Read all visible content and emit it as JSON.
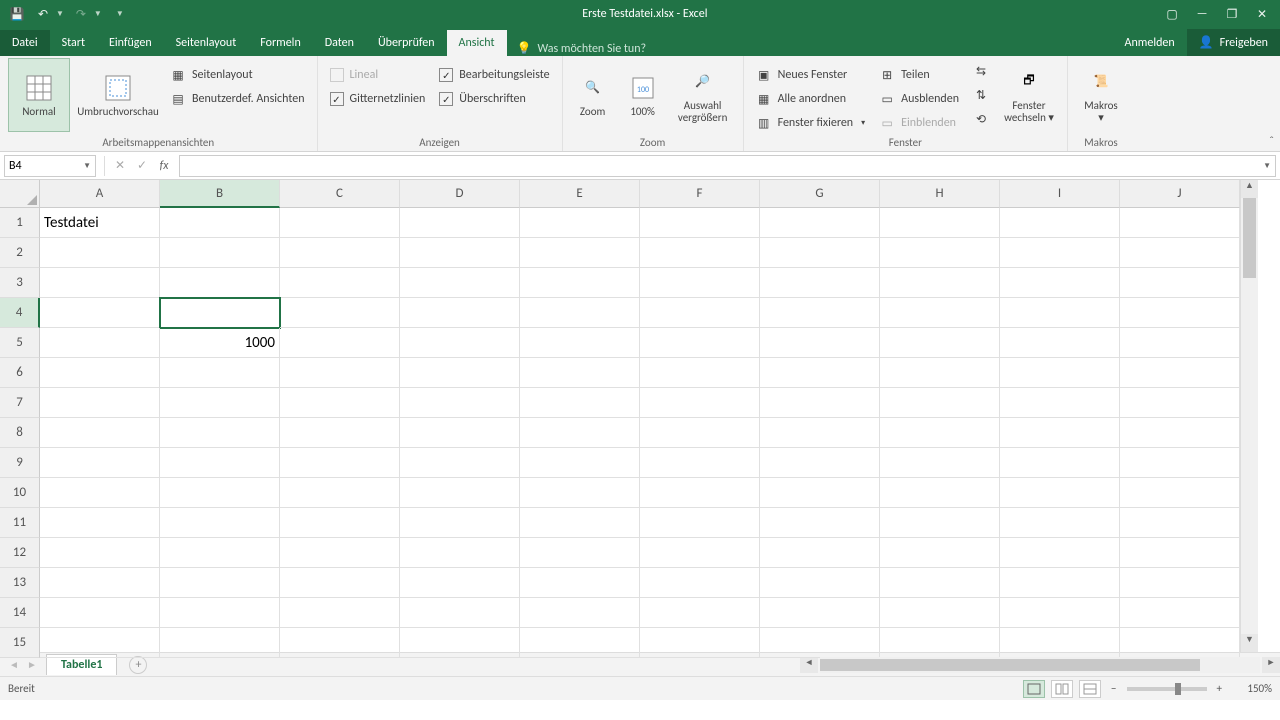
{
  "title": "Erste Testdatei.xlsx - Excel",
  "qat": {
    "save": "💾",
    "undo": "↶",
    "redo": "↷"
  },
  "tabs": {
    "file": "Datei",
    "start": "Start",
    "einfuegen": "Einfügen",
    "seitenlayout": "Seitenlayout",
    "formeln": "Formeln",
    "daten": "Daten",
    "ueberpruefen": "Überprüfen",
    "ansicht": "Ansicht",
    "tellme_placeholder": "Was möchten Sie tun?",
    "anmelden": "Anmelden",
    "freigeben": "Freigeben"
  },
  "ribbon": {
    "views": {
      "normal": "Normal",
      "umbruch": "Umbruchvorschau",
      "seitenlayout": "Seitenlayout",
      "benutzerdef": "Benutzerdef. Ansichten",
      "group": "Arbeitsmappenansichten"
    },
    "anzeigen": {
      "lineal": "Lineal",
      "bearbeitungsleiste": "Bearbeitungsleiste",
      "gitternetz": "Gitternetzlinien",
      "ueberschriften": "Überschriften",
      "group": "Anzeigen"
    },
    "zoom": {
      "zoom": "Zoom",
      "hundred": "100%",
      "auswahl_l1": "Auswahl",
      "auswahl_l2": "vergrößern",
      "group": "Zoom"
    },
    "fenster": {
      "neues": "Neues Fenster",
      "alle": "Alle anordnen",
      "fixieren": "Fenster fixieren",
      "teilen": "Teilen",
      "ausblenden": "Ausblenden",
      "einblenden": "Einblenden",
      "wechseln_l1": "Fenster",
      "wechseln_l2": "wechseln",
      "group": "Fenster"
    },
    "makros": {
      "label": "Makros",
      "group": "Makros"
    }
  },
  "namebox": "B4",
  "formula": "",
  "columns": [
    "A",
    "B",
    "C",
    "D",
    "E",
    "F",
    "G",
    "H",
    "I",
    "J"
  ],
  "rows": [
    "1",
    "2",
    "3",
    "4",
    "5",
    "6",
    "7",
    "8",
    "9",
    "10",
    "11",
    "12",
    "13",
    "14",
    "15"
  ],
  "selected": {
    "col": 1,
    "row": 3
  },
  "cells": {
    "A1": "Testdatei",
    "B5": "1000"
  },
  "sheet": {
    "tab": "Tabelle1"
  },
  "status": {
    "ready": "Bereit",
    "zoom": "150%",
    "minus": "−",
    "plus": "+"
  }
}
